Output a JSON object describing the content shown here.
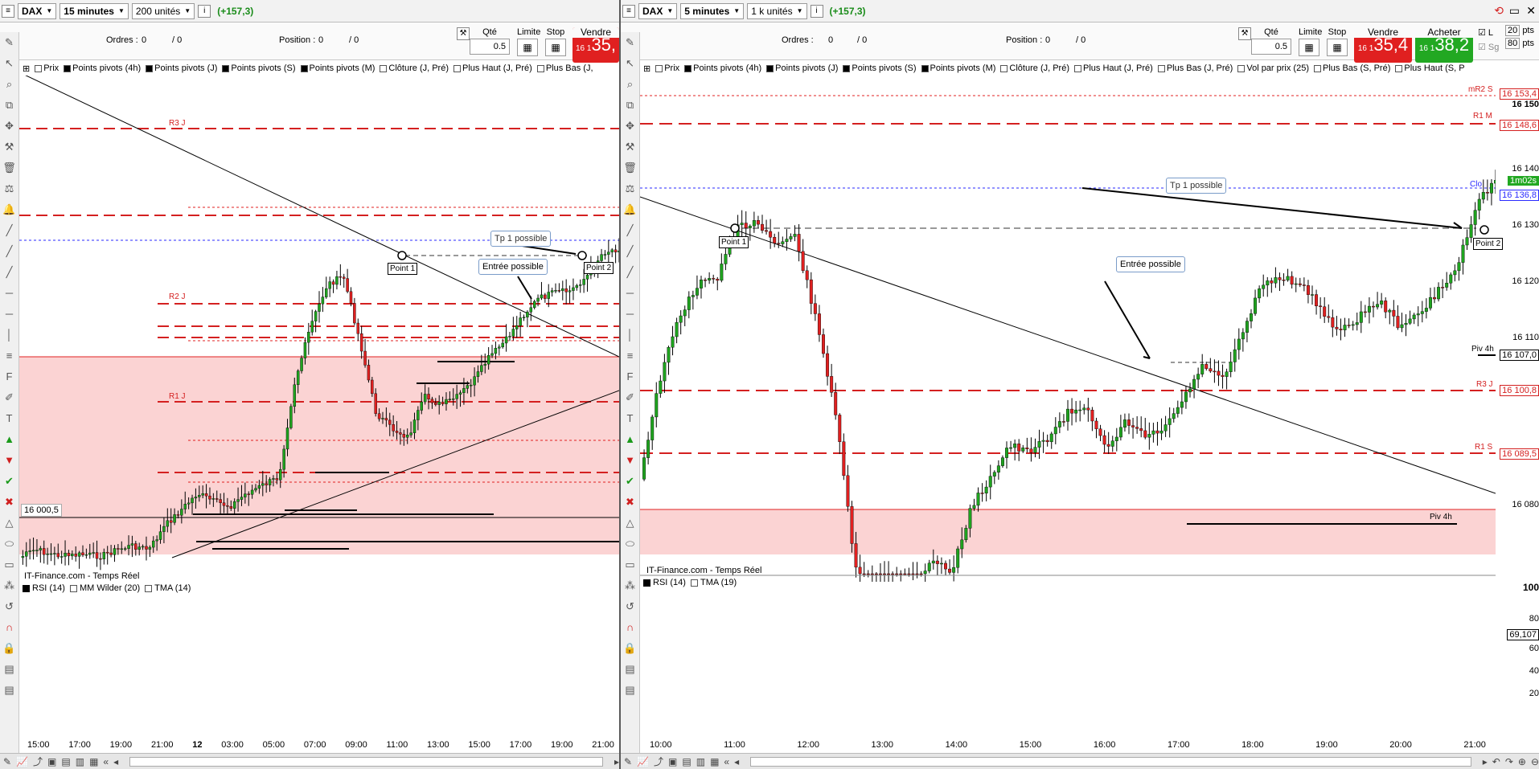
{
  "left": {
    "instrument": "DAX",
    "timeframe": "15 minutes",
    "units": "200 unités",
    "change": "(+157,3)",
    "orders_label": "Ordres :",
    "orders_value": "0",
    "orders_sep": "/ 0",
    "position_label": "Position :",
    "position_value": "0",
    "position_sep": "/ 0",
    "qty_label": "Qté",
    "qty_value": "0.5",
    "limit_label": "Limite",
    "stop_label": "Stop",
    "sell_label": "Vendre",
    "sell_small": "16 1",
    "sell_price": "35,",
    "legend": [
      "Prix",
      "Points pivots (4h)",
      "Points pivots (J)",
      "Points pivots (S)",
      "Points pivots (M)",
      "Clôture (J, Pré)",
      "Plus Haut (J, Pré)",
      "Plus Bas (J,"
    ],
    "level_labels": {
      "r3j": "R3 J",
      "r2j": "R2 J",
      "r1j": "R1 J"
    },
    "price_tag": "16 000,5",
    "annotations": {
      "tp": "Tp 1 possible",
      "entree": "Entrée possible",
      "point1": "Point 1",
      "point2": "Point 2"
    },
    "source": "IT-Finance.com - Temps Réel",
    "rsi_legend": [
      "RSI (14)",
      "MM Wilder (20)",
      "TMA (14)"
    ],
    "xticks": [
      "15:00",
      "17:00",
      "19:00",
      "21:00",
      "12",
      "03:00",
      "05:00",
      "07:00",
      "09:00",
      "11:00",
      "13:00",
      "15:00",
      "17:00",
      "19:00",
      "21:00"
    ]
  },
  "right": {
    "instrument": "DAX",
    "timeframe": "5 minutes",
    "units": "1 k unités",
    "change": "(+157,3)",
    "orders_label": "Ordres :",
    "orders_value": "0",
    "orders_sep": "/ 0",
    "position_label": "Position :",
    "position_value": "0",
    "position_sep": "/ 0",
    "qty_label": "Qté",
    "qty_value": "0.5",
    "limit_label": "Limite",
    "stop_label": "Stop",
    "sell_label": "Vendre",
    "sell_small": "16 1",
    "sell_price": "35,4",
    "buy_label": "Acheter",
    "buy_small": "16 1",
    "buy_price": "38,2",
    "side_opts": {
      "l": "L",
      "sg": "Sg",
      "pts1": "20",
      "pts1u": "pts",
      "pts2": "80",
      "pts2u": "pts"
    },
    "legend": [
      "Prix",
      "Points pivots (4h)",
      "Points pivots (J)",
      "Points pivots (S)",
      "Points pivots (M)",
      "Clôture (J, Pré)",
      "Plus Haut (J, Pré)",
      "Plus Bas (J, Pré)",
      "Vol par prix (25)",
      "Plus Bas (S, Pré)",
      "Plus Haut (S, P"
    ],
    "yticks": [
      "16 150",
      "16 140",
      "16 130",
      "16 120",
      "16 110",
      "16 080"
    ],
    "price_boxes": [
      "16 153,4",
      "16 148,6",
      "16 136,8",
      "16 107,0",
      "16 100,8",
      "16 089,5"
    ],
    "timer": "1m02s",
    "clo": "Clo",
    "level_labels": {
      "mr2s": "mR2 S",
      "r1m": "R1 M",
      "piv4h": "Piv 4h",
      "r3j": "R3 J",
      "r1s": "R1 S",
      "piv4h2": "Piv 4h"
    },
    "annotations": {
      "tp": "Tp 1 possible",
      "entree": "Entrée possible",
      "point1": "Point 1",
      "point2": "Point 2"
    },
    "source": "IT-Finance.com - Temps Réel",
    "rsi_legend": [
      "RSI (14)",
      "TMA (19)"
    ],
    "rsi_ticks": [
      "100",
      "80",
      "60",
      "40",
      "20"
    ],
    "rsi_value": "69,107",
    "xticks": [
      "10:00",
      "11:00",
      "12:00",
      "13:00",
      "14:00",
      "15:00",
      "16:00",
      "17:00",
      "18:00",
      "19:00",
      "20:00",
      "21:00"
    ]
  },
  "colors": {
    "up": "#1fa31f",
    "down": "#e02020",
    "zone": "#fbd3d3",
    "pivot": "#d42020",
    "blue": "#2a2aff"
  }
}
